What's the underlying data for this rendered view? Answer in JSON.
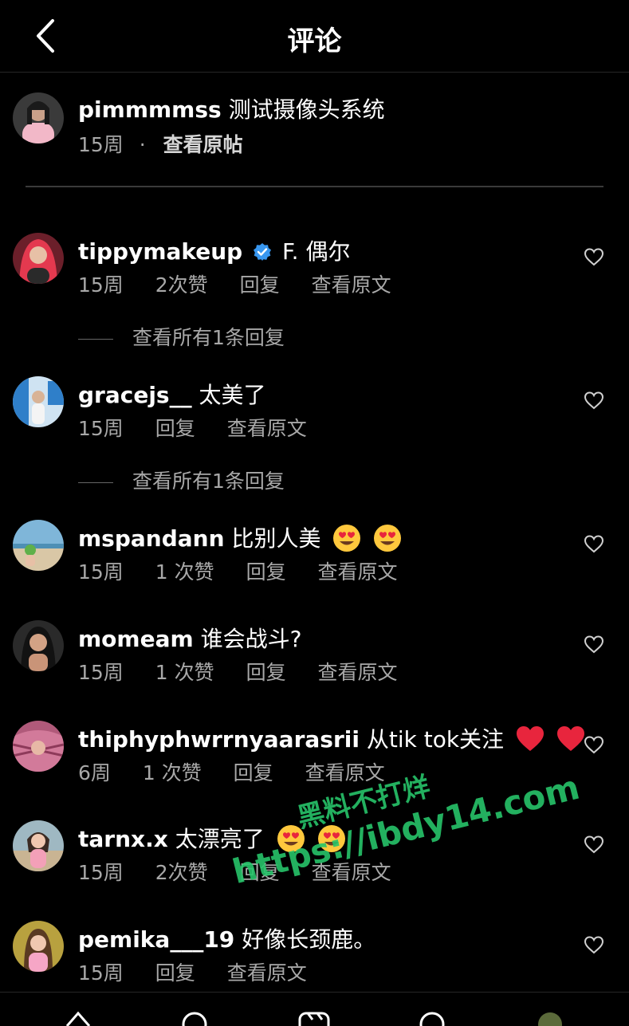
{
  "header": {
    "title": "评论",
    "back_icon": "chevron-left-icon"
  },
  "post": {
    "username": "pimmmmss",
    "caption": "测试摄像头系统",
    "time": "15周",
    "separator": "·",
    "view_post": "查看原帖"
  },
  "comments": [
    {
      "username": "tippymakeup",
      "verified": true,
      "text": "F. 偶尔",
      "time": "15周",
      "likes": "2次赞",
      "reply": "回复",
      "see_translation": "查看原文",
      "view_replies": "查看所有1条回复"
    },
    {
      "username": "gracejs__",
      "text": "太美了",
      "time": "15周",
      "reply": "回复",
      "see_translation": "查看原文",
      "view_replies": "查看所有1条回复"
    },
    {
      "username": "mspandann",
      "text": "比别人美",
      "emojis": [
        "heart-eyes-emoji",
        "heart-eyes-emoji"
      ],
      "time": "15周",
      "likes": "1 次赞",
      "reply": "回复",
      "see_translation": "查看原文"
    },
    {
      "username": "momeam",
      "text": "谁会战斗?",
      "time": "15周",
      "likes": "1 次赞",
      "reply": "回复",
      "see_translation": "查看原文"
    },
    {
      "username": "thiphyphwrrnyaarasrii",
      "text": "从tik tok关注",
      "emojis": [
        "red-heart-emoji",
        "red-heart-emoji"
      ],
      "time": "6周",
      "likes": "1 次赞",
      "reply": "回复",
      "see_translation": "查看原文"
    },
    {
      "username": "tarnx.x",
      "text": "太漂亮了",
      "emojis": [
        "heart-eyes-emoji",
        "heart-eyes-emoji"
      ],
      "time": "15周",
      "likes": "2次赞",
      "reply": "回复",
      "see_translation": "查看原文"
    },
    {
      "username": "pemika___19",
      "text": "好像长颈鹿。",
      "time": "15周",
      "reply": "回复",
      "see_translation": "查看原文"
    }
  ],
  "watermark": {
    "line1": "黑料不打烊",
    "line2": "https://ibdy14.com"
  },
  "colors": {
    "background": "#000000",
    "text": "#ffffff",
    "secondary": "#a8a8a8",
    "verified": "#3897f0",
    "watermark": "#27c46a"
  }
}
